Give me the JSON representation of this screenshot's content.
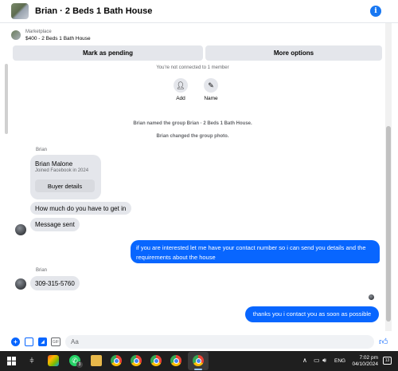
{
  "header": {
    "title": "Brian · 2 Beds 1 Bath House",
    "info_icon": "info-icon"
  },
  "marketplace": {
    "label": "Marketplace",
    "item": "$400 - 2 Beds 1 Bath House"
  },
  "buttons": {
    "mark_pending": "Mark as pending",
    "more_options": "More options"
  },
  "notices": {
    "not_connected": "You're not connected to 1 member",
    "named_group": "Brian named the group Brian · 2 Beds 1 Bath House.",
    "changed_photo": "Brian changed the group photo."
  },
  "actions": {
    "add": "Add",
    "name": "Name"
  },
  "conversation": {
    "sender_name": "Brian",
    "card": {
      "name": "Brian Malone",
      "sub": "Joined Facebook in 2024",
      "button": "Buyer details"
    },
    "msg_how_much": "How much do you have to get in",
    "msg_sent": "Message sent",
    "msg_reply": "if you are interested let me have your contact number so i can send you details and the requirements about the house",
    "msg_phone": "309-315-5760",
    "msg_thanks": "thanks you i contact you as soon as possible"
  },
  "composer": {
    "placeholder": "Aa",
    "like_icon": "thumbs-up-icon"
  },
  "taskbar": {
    "whatsapp_badge": "3",
    "language": "ENG",
    "time": "7:02 pm",
    "date": "04/10/2024",
    "notifications": "13"
  },
  "colors": {
    "accent": "#0866ff",
    "bubble_in": "#e4e6eb",
    "taskbar": "#1f1f1f"
  }
}
